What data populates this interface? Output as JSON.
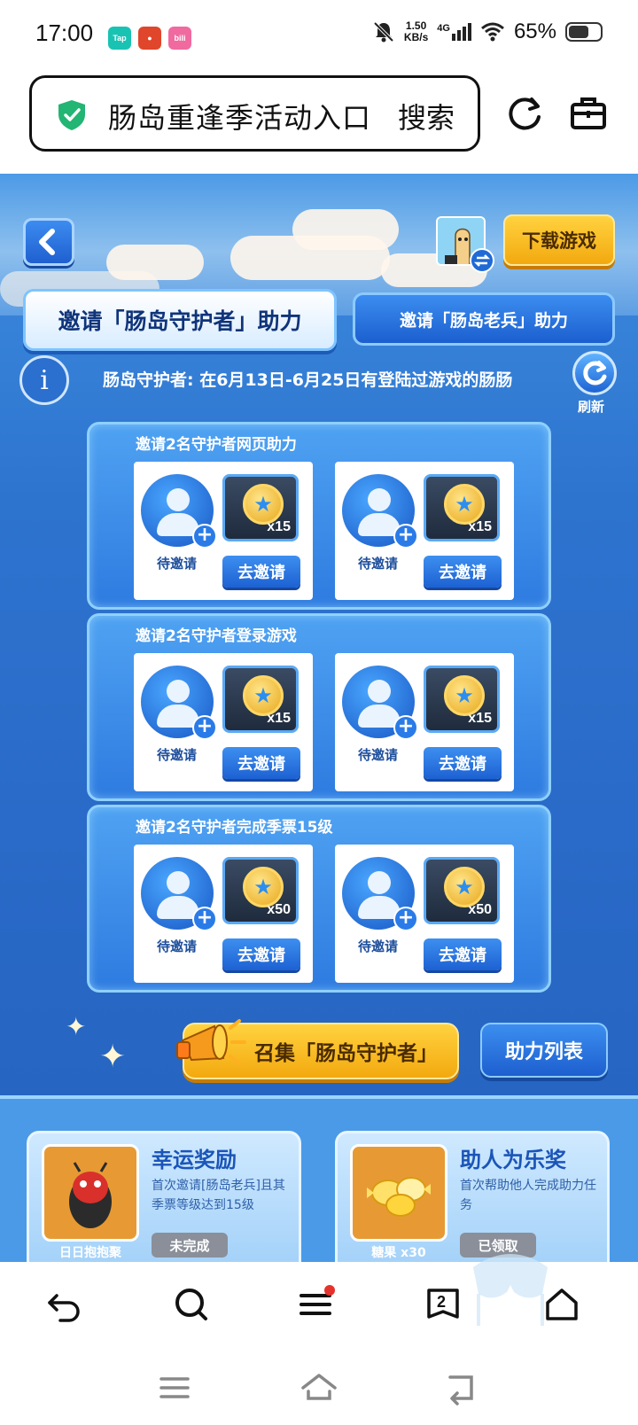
{
  "status_bar": {
    "time": "17:00",
    "app_badges": [
      "Tap",
      "",
      "bili"
    ],
    "net_speed_value": "1.50",
    "net_speed_unit": "KB/s",
    "network_type": "4G",
    "battery_percent": "65%",
    "battery_level": 0.65
  },
  "search": {
    "query": "肠岛重逢季活动入口",
    "button_label": "搜索"
  },
  "game": {
    "download_label": "下载游戏",
    "tabs": [
      {
        "label": "邀请「肠岛守护者」助力",
        "active": true
      },
      {
        "label": "邀请「肠岛老兵」助力",
        "active": false
      }
    ],
    "info_text": "肠岛守护者: 在6月13日-6月25日有登陆过游戏的肠肠",
    "refresh_label": "刷新",
    "tasks": [
      {
        "title": "邀请2名守护者网页助力",
        "slots": [
          {
            "status": "待邀请",
            "reward": "x15",
            "button": "去邀请"
          },
          {
            "status": "待邀请",
            "reward": "x15",
            "button": "去邀请"
          }
        ]
      },
      {
        "title": "邀请2名守护者登录游戏",
        "slots": [
          {
            "status": "待邀请",
            "reward": "x15",
            "button": "去邀请"
          },
          {
            "status": "待邀请",
            "reward": "x15",
            "button": "去邀请"
          }
        ]
      },
      {
        "title": "邀请2名守护者完成季票15级",
        "slots": [
          {
            "status": "待邀请",
            "reward": "x50",
            "button": "去邀请"
          },
          {
            "status": "待邀请",
            "reward": "x50",
            "button": "去邀请"
          }
        ]
      }
    ],
    "summon_label": "召集「肠岛守护者」",
    "help_list_label": "助力列表",
    "reward_cards": [
      {
        "title": "幸运奖励",
        "desc": "首次邀请[肠岛老兵]且其季票等级达到15级",
        "status": "未完成",
        "item_name": "日日抱抱聚"
      },
      {
        "title": "助人为乐奖",
        "desc": "首次帮助他人完成助力任务",
        "status": "已领取",
        "item_name": "糖果 x30"
      }
    ]
  },
  "browser_toolbar": {
    "tab_count": "2"
  },
  "colors": {
    "accent_blue": "#2a6ac8",
    "button_yellow": "#f3a90f",
    "shield_green": "#22b573",
    "notification_red": "#e5322d"
  }
}
